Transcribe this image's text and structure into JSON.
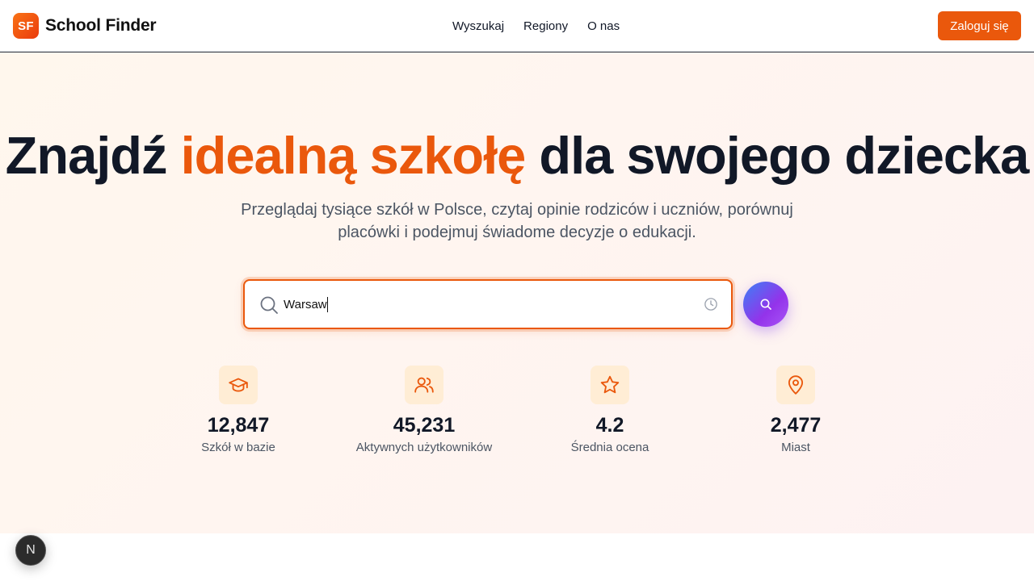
{
  "header": {
    "logo_text": "SF",
    "brand_name": "School Finder",
    "nav": [
      {
        "label": "Wyszukaj"
      },
      {
        "label": "Regiony"
      },
      {
        "label": "O nas"
      }
    ],
    "login_label": "Zaloguj się"
  },
  "hero": {
    "title_before": "Znajdź ",
    "title_accent": "idealną szkołę",
    "title_after": " dla swojego dziecka",
    "subtitle": "Przeglądaj tysiące szkół w Polsce, czytaj opinie rodziców i uczniów, porównuj placówki i podejmuj świadome decyzje o edukacji."
  },
  "search": {
    "value": "Warsaw",
    "icon": "search-icon",
    "history_icon": "clock-icon"
  },
  "stats": [
    {
      "icon": "graduation-cap-icon",
      "value": "12,847",
      "label": "Szkół w bazie"
    },
    {
      "icon": "users-icon",
      "value": "45,231",
      "label": "Aktywnych użytkowników"
    },
    {
      "icon": "star-icon",
      "value": "4.2",
      "label": "Średnia ocena"
    },
    {
      "icon": "map-pin-icon",
      "value": "2,477",
      "label": "Miast"
    }
  ],
  "badge": {
    "letter": "N"
  },
  "colors": {
    "accent": "#ea580c",
    "icon_bg": "#ffedd5",
    "search_gradient_start": "#3b82f6",
    "search_gradient_end": "#a855f7"
  }
}
